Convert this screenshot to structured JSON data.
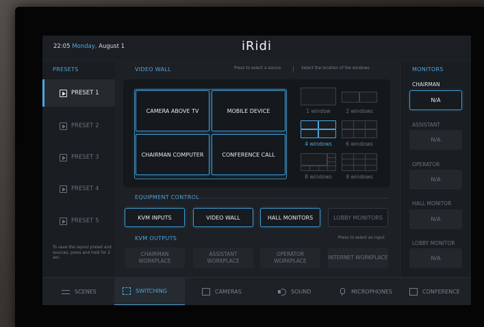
{
  "header": {
    "time": "22:05",
    "day": "Monday,",
    "date": "August 1",
    "logo": "iRidi"
  },
  "presets": {
    "title": "PRESETS",
    "items": [
      "PRESET 1",
      "PRESET 2",
      "PRESET 3",
      "PRESET 4",
      "PRESET 5"
    ],
    "active": "PRESET 1",
    "note": "To save the layout preset and sources, press and hold for 2 sec."
  },
  "video_wall": {
    "title": "VIDEO WALL",
    "hint_source": "Press to select a source",
    "hint_location": "Select the location of the windows",
    "tiles": [
      "CAMERA ABOVE TV",
      "MOBILE DEVICE",
      "CHAIRMAN COMPUTER",
      "CONFERENCE CALL"
    ],
    "layouts": [
      "1 window",
      "2 windows",
      "4 windows",
      "6 windows",
      "8 windows",
      "9 windows"
    ],
    "selected_layout": "4 windows"
  },
  "equipment": {
    "title": "EQUIPMENT CONTROL",
    "buttons": [
      "KVM INPUTS",
      "VIDEO WALL",
      "HALL MONITORS",
      "LOBBY MONITORS"
    ]
  },
  "kvm": {
    "title": "KVM OUTPUTS",
    "hint": "Press to select an input",
    "outputs": [
      "CHAIRMAN WORKPLACE",
      "ASSISTANT WORKPLACE",
      "OPERATOR WORKPLACE",
      "INTERNET WORKPLACE"
    ]
  },
  "monitors": {
    "title": "MONITORS",
    "items": [
      {
        "label": "CHAIRMAN",
        "value": "N/A"
      },
      {
        "label": "ASSISTANT",
        "value": "N/A"
      },
      {
        "label": "OPERATOR",
        "value": "N/A"
      },
      {
        "label": "HALL MONITOR",
        "value": "N/A"
      },
      {
        "label": "LOBBY MONITOR",
        "value": "N/A"
      }
    ]
  },
  "tabs": [
    "SCENES",
    "SWITCHING",
    "CAMERAS",
    "SOUND",
    "MICROPHONES",
    "CONFERENCE"
  ],
  "active_tab": "SWITCHING",
  "icons": [
    "sliders-icon",
    "switching-icon",
    "camera-icon",
    "speaker-icon",
    "microphone-icon",
    "conference-icon",
    "play-icon"
  ],
  "colors": {
    "accent": "#4fa6e0",
    "background": "#1d2024"
  }
}
